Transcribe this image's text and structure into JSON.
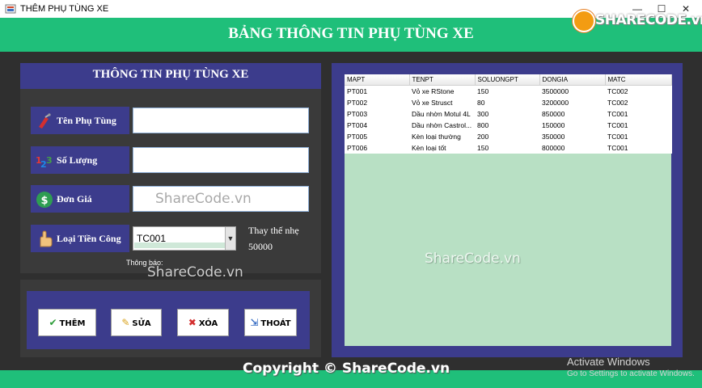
{
  "window": {
    "title": "THÊM PHỤ TÙNG XE",
    "minimize_glyph": "—",
    "maximize_glyph": "☐",
    "close_glyph": "✕"
  },
  "brand": {
    "text": "SHARECODE.vn"
  },
  "header": {
    "title": "BẢNG THÔNG TIN PHỤ TÙNG XE"
  },
  "form": {
    "title": "THÔNG TIN PHỤ TÙNG XE",
    "fields": {
      "name": {
        "label": "Tên Phụ Tùng",
        "icon": "fuel-pump-icon",
        "value": ""
      },
      "quantity": {
        "label": "Số Lượng",
        "icon": "numbers-123-icon",
        "value": ""
      },
      "price": {
        "label": "Đơn Giá",
        "icon": "dollar-coin-icon",
        "value": ""
      },
      "fee_type": {
        "label": "Loại Tiền Công",
        "icon": "hand-pointer-icon",
        "selected": "TC001"
      }
    },
    "fee_name": "Thay thế nhẹ",
    "fee_amount": "50000",
    "notice_label": "Thông báo:"
  },
  "buttons": {
    "add": {
      "label": "THÊM",
      "icon": "check-icon"
    },
    "edit": {
      "label": "SỬA",
      "icon": "pencil-icon"
    },
    "delete": {
      "label": "XÓA",
      "icon": "x-icon"
    },
    "exit": {
      "label": "THOÁT",
      "icon": "exit-door-icon"
    }
  },
  "table": {
    "columns": [
      "MAPT",
      "TENPT",
      "SOLUONGPT",
      "DONGIA",
      "MATC"
    ],
    "rows": [
      [
        "PT001",
        "Vỏ xe RStone",
        "150",
        "3500000",
        "TC002"
      ],
      [
        "PT002",
        "Vỏ xe Strusct",
        "80",
        "3200000",
        "TC002"
      ],
      [
        "PT003",
        "Dầu nhờn Motul 4L",
        "300",
        "850000",
        "TC001"
      ],
      [
        "PT004",
        "Dầu nhờn Castrol...",
        "800",
        "150000",
        "TC001"
      ],
      [
        "PT005",
        "Kèn loại thường",
        "200",
        "350000",
        "TC001"
      ],
      [
        "PT006",
        "Kèn loại tốt",
        "150",
        "800000",
        "TC001"
      ]
    ]
  },
  "watermarks": {
    "center": "ShareCode.vn",
    "copyright": "Copyright © ShareCode.vn"
  },
  "os_notice": {
    "title": "Activate Windows",
    "subtitle": "Go to Settings to activate Windows."
  },
  "colors": {
    "accent_green": "#1fbf7a",
    "panel_blue": "#3c3c8c",
    "body_dark": "#2f2f2f",
    "table_bg": "#b8e0c4"
  }
}
